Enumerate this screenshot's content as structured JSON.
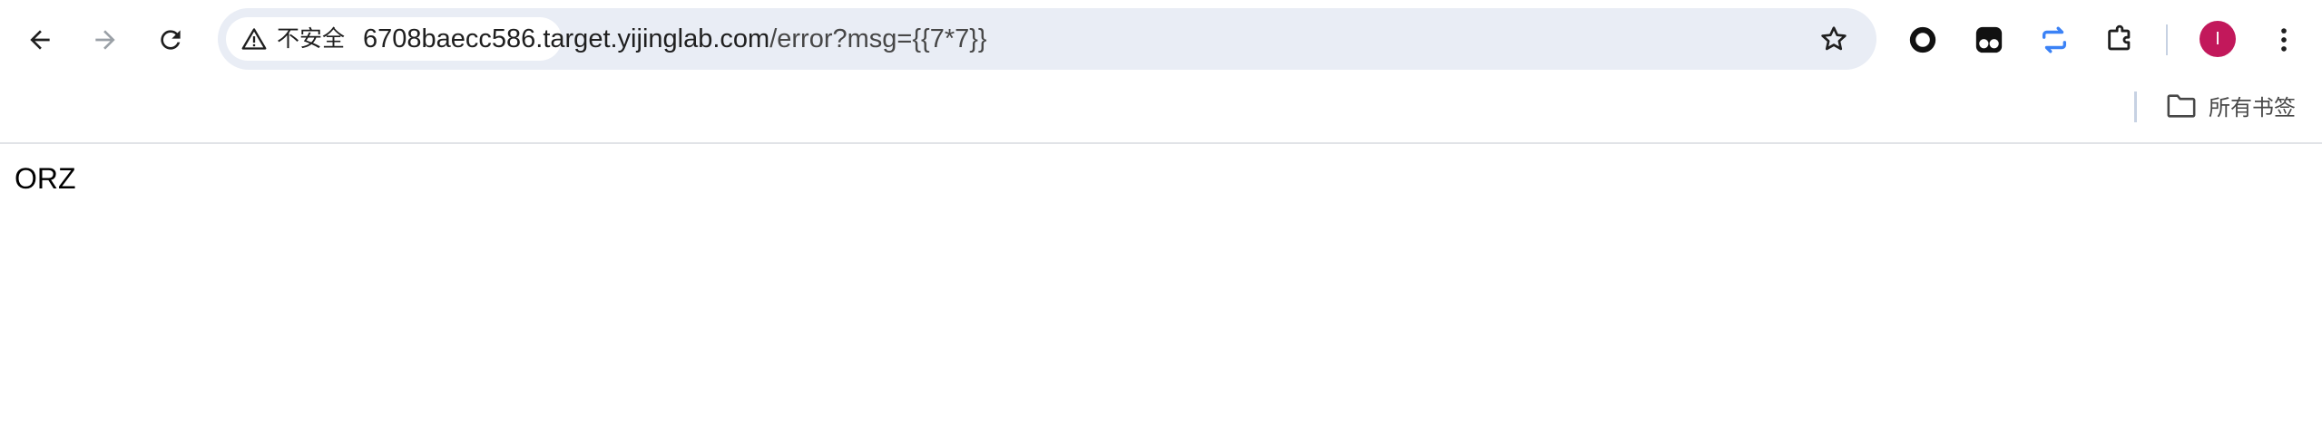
{
  "toolbar": {
    "back_icon": "arrow-left-icon",
    "forward_icon": "arrow-right-icon",
    "reload_icon": "reload-icon",
    "security_label": "不安全",
    "url_host": "6708baecc586.target.yijinglab.com",
    "url_path": "/error?msg={{7*7}}",
    "bookmark_star_icon": "star-outline-icon",
    "extensions": [
      "circle-extension-icon",
      "tampermonkey-icon",
      "sync-arrows-icon",
      "puzzle-extensions-icon"
    ],
    "profile_initial": "I",
    "menu_icon": "kebab-menu-icon",
    "accent_color": "#c2185b"
  },
  "bookmarks_bar": {
    "all_bookmarks_label": "所有书签",
    "folder_icon": "folder-icon"
  },
  "page": {
    "body_text": "ORZ"
  }
}
